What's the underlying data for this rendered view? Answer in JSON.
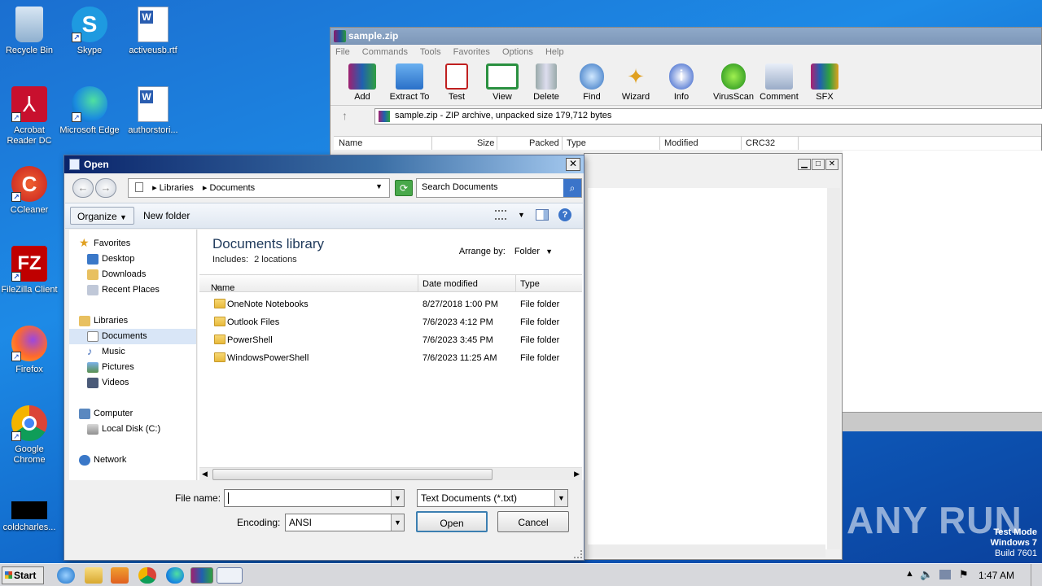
{
  "desktop": {
    "icons": [
      {
        "label": "Recycle Bin"
      },
      {
        "label": "Skype"
      },
      {
        "label": "activeusb.rtf"
      },
      {
        "label": "Acrobat Reader DC"
      },
      {
        "label": "Microsoft Edge"
      },
      {
        "label": "authorstori..."
      },
      {
        "label": "CCleaner"
      },
      {
        "label": "FileZilla Client"
      },
      {
        "label": "Firefox"
      },
      {
        "label": "Google Chrome"
      },
      {
        "label": "coldcharles..."
      }
    ],
    "watermark": "ANY RUN",
    "test_mode": {
      "line1": "Test Mode",
      "line2": "Windows 7",
      "line3": "Build 7601"
    }
  },
  "winrar": {
    "title": "sample.zip",
    "menu": [
      "File",
      "Commands",
      "Tools",
      "Favorites",
      "Options",
      "Help"
    ],
    "toolbar": [
      "Add",
      "Extract To",
      "Test",
      "View",
      "Delete",
      "Find",
      "Wizard",
      "Info",
      "VirusScan",
      "Comment",
      "SFX"
    ],
    "address": "sample.zip - ZIP archive, unpacked size 179,712 bytes",
    "columns": [
      "Name",
      "Size",
      "Packed",
      "Type",
      "Modified",
      "CRC32"
    ]
  },
  "dialog": {
    "title": "Open",
    "breadcrumb": [
      "Libraries",
      "Documents"
    ],
    "search_placeholder": "Search Documents",
    "organize": "Organize",
    "new_folder": "New folder",
    "nav": {
      "favorites": "Favorites",
      "desktop": "Desktop",
      "downloads": "Downloads",
      "recent": "Recent Places",
      "libraries": "Libraries",
      "documents": "Documents",
      "music": "Music",
      "pictures": "Pictures",
      "videos": "Videos",
      "computer": "Computer",
      "local_disk": "Local Disk (C:)",
      "network": "Network"
    },
    "library_title": "Documents library",
    "library_includes": "Includes:",
    "library_locations": "2 locations",
    "arrange_by": "Arrange by:",
    "arrange_value": "Folder",
    "columns": {
      "name": "Name",
      "date": "Date modified",
      "type": "Type"
    },
    "rows": [
      {
        "name": "OneNote Notebooks",
        "date": "8/27/2018 1:00 PM",
        "type": "File folder"
      },
      {
        "name": "Outlook Files",
        "date": "7/6/2023 4:12 PM",
        "type": "File folder"
      },
      {
        "name": "PowerShell",
        "date": "7/6/2023 3:45 PM",
        "type": "File folder"
      },
      {
        "name": "WindowsPowerShell",
        "date": "7/6/2023 11:25 AM",
        "type": "File folder"
      }
    ],
    "file_name_label": "File name:",
    "file_name_value": "",
    "file_type": "Text Documents (*.txt)",
    "encoding_label": "Encoding:",
    "encoding_value": "ANSI",
    "open_button": "Open",
    "cancel_button": "Cancel"
  },
  "taskbar": {
    "start": "Start",
    "clock": "1:47 AM"
  }
}
